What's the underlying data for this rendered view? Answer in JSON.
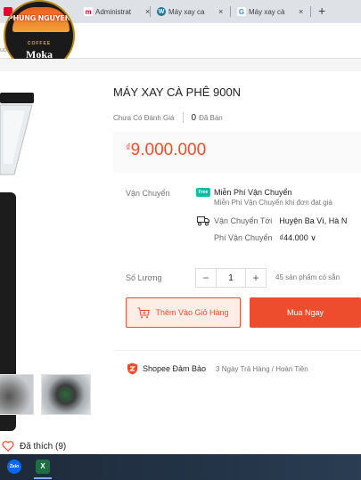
{
  "browser": {
    "tabs": [
      {
        "title": "Administrat",
        "favicon": "m-favicon",
        "color": "#e4002b"
      },
      {
        "title": "Máy xay ca",
        "favicon": "wordpress-icon",
        "color": "#21759b"
      },
      {
        "title": "Máy xay cà",
        "favicon": "google-icon",
        "color": "#ffffff"
      }
    ],
    "new_tab": "+",
    "close": "×"
  },
  "logo": {
    "brand": "PHUNG NGUYEN",
    "sub": "COFFEE",
    "name": "Moka"
  },
  "breadcrumb": "uộ",
  "product": {
    "title": "MÁY XAY CÀ PHÊ 900N",
    "rating_text": "Chưa Có Đánh Giá",
    "sold_count": "0",
    "sold_label": "Đã Bán",
    "currency": "₫",
    "price": "9.000.000"
  },
  "shipping": {
    "label": "Vận Chuyển",
    "free_badge": "Free",
    "free_title": "Miễn Phí Vận Chuyển",
    "free_desc": "Miễn Phí Vận Chuyển khi đơn đạt giá",
    "to_label": "Vận Chuyển Tới",
    "destination": "Huyện Ba Vì, Hà N",
    "fee_label": "Phí Vận Chuyển",
    "fee_value": "₫44.000 ∨"
  },
  "quantity": {
    "label": "Số Lượng",
    "minus": "−",
    "value": "1",
    "plus": "+",
    "stock": "45 sản phẩm có sẵn"
  },
  "actions": {
    "add_to_cart": "Thêm Vào Giỏ Hàng",
    "buy_now": "Mua Ngay"
  },
  "guarantee": {
    "title": "Shopee Đảm Bảo",
    "desc": "3 Ngày Trả Hàng / Hoàn Tiền"
  },
  "like": {
    "text": "Đã thích (9)"
  },
  "taskbar": {
    "apps": [
      {
        "name": "Zalo",
        "label": "Zalo"
      },
      {
        "name": "Excel",
        "label": "X"
      }
    ]
  },
  "colors": {
    "accent": "#ee4d2d",
    "free_badge": "#00bfa5",
    "taskbar": "#1e2a3a"
  }
}
